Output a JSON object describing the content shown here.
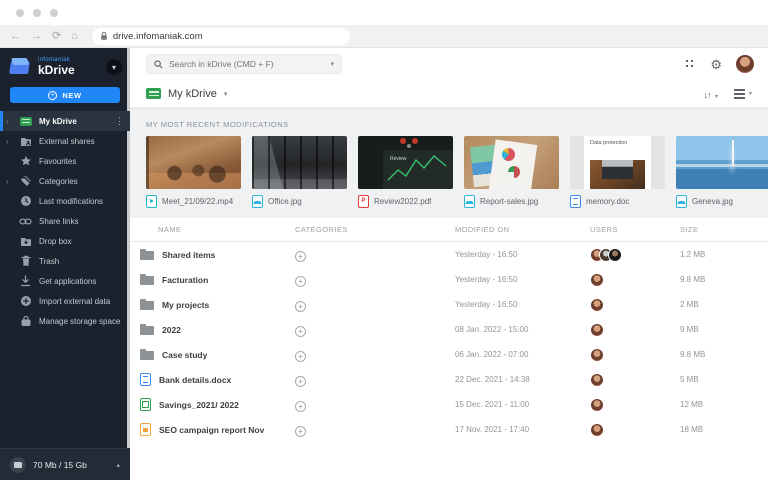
{
  "colors": {
    "accent_blue": "#1f87f7",
    "sidebar_bg": "#1b222d",
    "brand_blue": "#3fa4ff",
    "drive_green": "#2f9e4f",
    "page_bg": "#f0f1f2"
  },
  "browser": {
    "url": "drive.infomaniak.com"
  },
  "sidebar": {
    "brand": {
      "company": "infomaniak",
      "product": "kDrive"
    },
    "new_button": "NEW",
    "items": [
      {
        "label": "My kDrive",
        "icon": "drive-icon",
        "expandable": true,
        "selected": true
      },
      {
        "label": "External shares",
        "icon": "shared-folder-icon",
        "expandable": true,
        "selected": false
      },
      {
        "label": "Favourites",
        "icon": "star-icon",
        "expandable": false,
        "selected": false
      },
      {
        "label": "Categories",
        "icon": "tags-icon",
        "expandable": true,
        "selected": false
      },
      {
        "label": "Last modifications",
        "icon": "clock-icon",
        "expandable": false,
        "selected": false
      },
      {
        "label": "Share links",
        "icon": "link-icon",
        "expandable": false,
        "selected": false
      },
      {
        "label": "Drop box",
        "icon": "dropbox-icon",
        "expandable": false,
        "selected": false
      },
      {
        "label": "Trash",
        "icon": "trash-icon",
        "expandable": false,
        "selected": false
      },
      {
        "label": "Get applications",
        "icon": "download-icon",
        "expandable": false,
        "selected": false
      },
      {
        "label": "Import external data",
        "icon": "import-icon",
        "expandable": false,
        "selected": false
      },
      {
        "label": "Manage storage space",
        "icon": "storage-icon",
        "expandable": false,
        "selected": false
      }
    ],
    "storage": {
      "usage": "70 Mb / 15 Gb"
    }
  },
  "topbar": {
    "search_placeholder": "Search in kDrive (CMD + F)"
  },
  "breadcrumb": {
    "title": "My kDrive"
  },
  "recent": {
    "title": "MY MOST RECENT MODIFICATIONS",
    "cards": [
      {
        "name": "Meet_21/09/22.mp4",
        "type": "video"
      },
      {
        "name": "Office.jpg",
        "type": "image"
      },
      {
        "name": "Review2022.pdf",
        "type": "pdf"
      },
      {
        "name": "Report-sales.jpg",
        "type": "image"
      },
      {
        "name": "memory.doc",
        "type": "doc",
        "preview_title": "Data protection"
      },
      {
        "name": "Geneva.jpg",
        "type": "image"
      }
    ]
  },
  "table": {
    "columns": [
      "NAME",
      "CATEGORIES",
      "MODIFIED ON",
      "USERS",
      "SIZE"
    ],
    "rows": [
      {
        "name": "Shared items",
        "type": "folder",
        "modified": "Yesterday - 16:50",
        "users": 3,
        "size": "1.2 MB"
      },
      {
        "name": "Facturation",
        "type": "folder",
        "modified": "Yesterday - 16:50",
        "users": 1,
        "size": "9.8 MB"
      },
      {
        "name": "My projects",
        "type": "folder",
        "modified": "Yesterday - 16:50",
        "users": 1,
        "size": "2 MB"
      },
      {
        "name": "2022",
        "type": "folder",
        "modified": "08 Jan. 2022 - 15:00",
        "users": 1,
        "size": "9 MB"
      },
      {
        "name": "Case study",
        "type": "folder",
        "modified": "06 Jan. 2022 - 07:00",
        "users": 1,
        "size": "9.8 MB"
      },
      {
        "name": "Bank details.docx",
        "type": "doc",
        "modified": "22 Dec. 2021 - 14:38",
        "users": 1,
        "size": "5 MB"
      },
      {
        "name": "Savings_2021/ 2022",
        "type": "sheet",
        "modified": "15 Dec. 2021 - 11:00",
        "users": 1,
        "size": "12 MB"
      },
      {
        "name": "SEO campaign report Nov",
        "type": "slide",
        "modified": "17 Nov. 2021 - 17:40",
        "users": 1,
        "size": "18 MB"
      }
    ]
  }
}
